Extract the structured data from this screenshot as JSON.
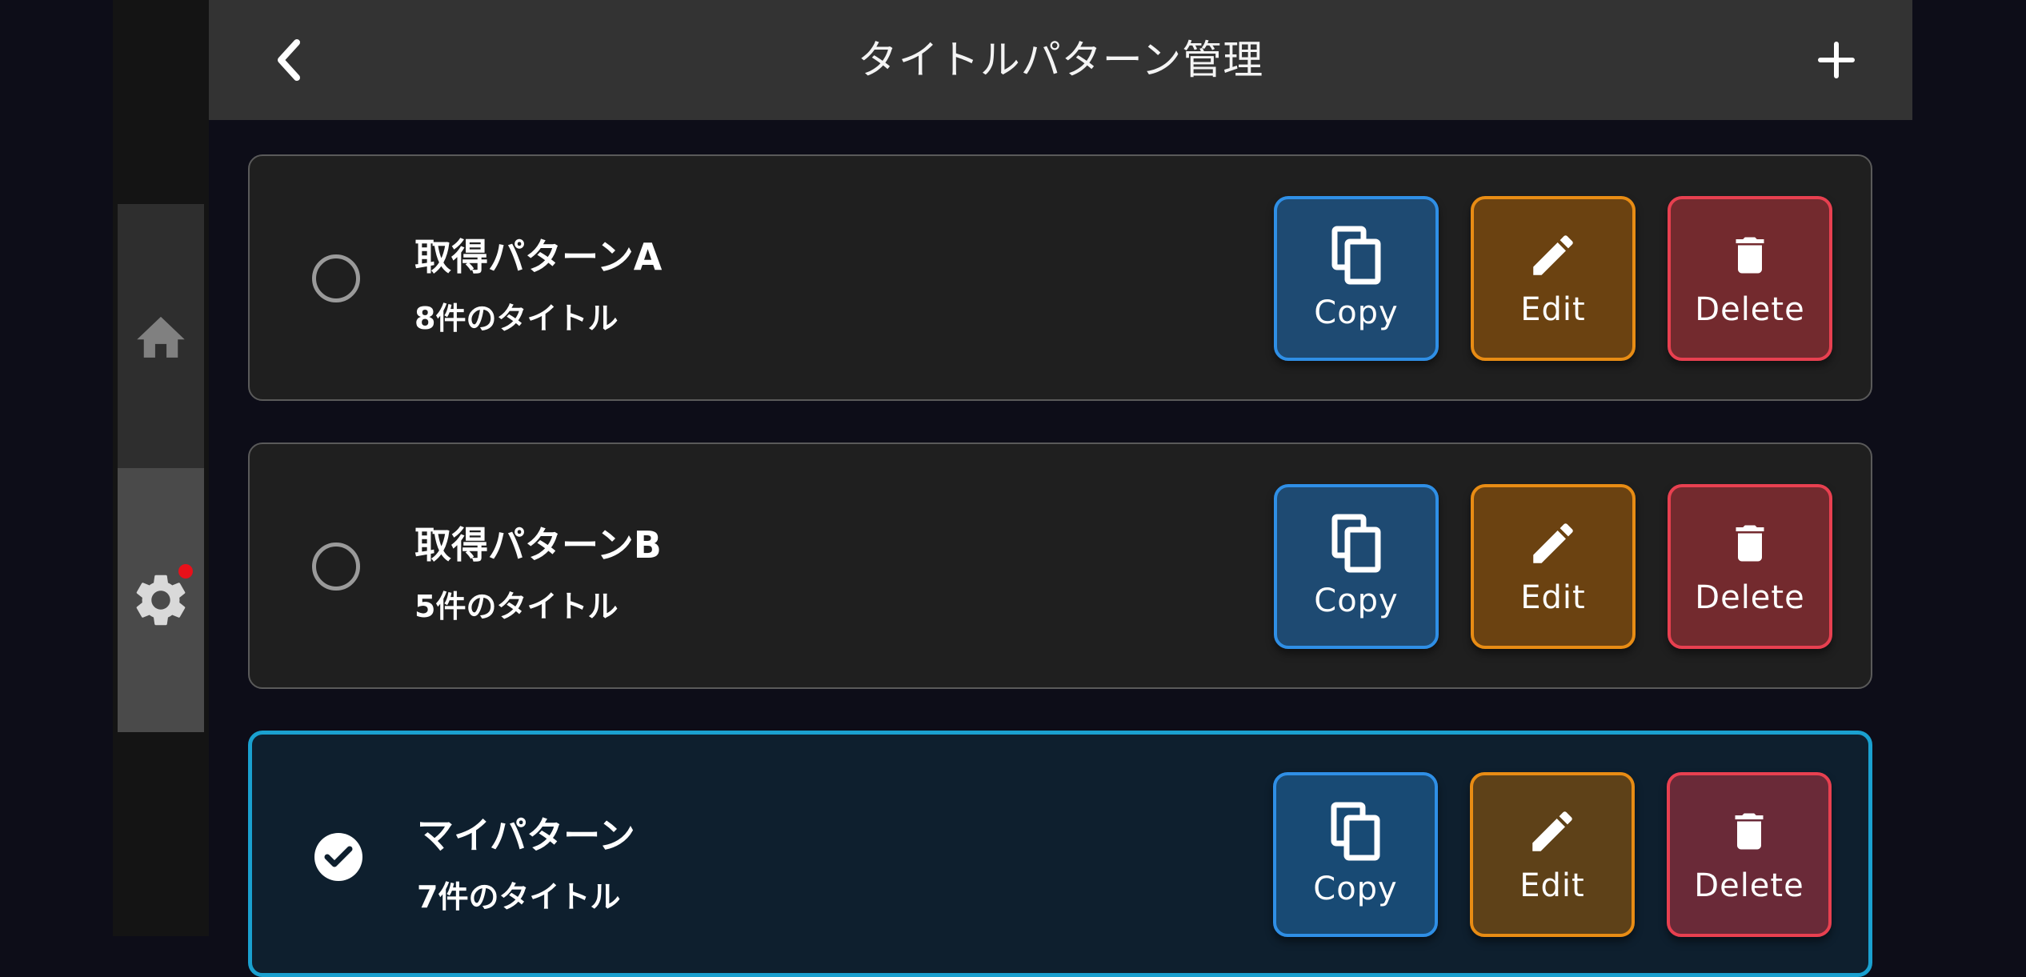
{
  "header": {
    "title": "タイトルパターン管理",
    "back_icon": "chevron-left-icon",
    "add_icon": "plus-icon"
  },
  "nav": {
    "items": [
      {
        "name": "home",
        "icon": "home-icon",
        "active": false
      },
      {
        "name": "settings",
        "icon": "gear-icon",
        "active": true,
        "notification": true
      }
    ]
  },
  "patterns": [
    {
      "name": "取得パターンA",
      "count_text": "8件のタイトル",
      "selected": false
    },
    {
      "name": "取得パターンB",
      "count_text": "5件のタイトル",
      "selected": false
    },
    {
      "name": "マイパターン",
      "count_text": "7件のタイトル",
      "selected": true
    }
  ],
  "actions": {
    "copy_label": "Copy",
    "edit_label": "Edit",
    "delete_label": "Delete"
  },
  "colors": {
    "background": "#0d0d18",
    "header": "#333333",
    "card": "#1f1f1f",
    "selected_border": "#1aa0cf",
    "copy": "#2f8fe6",
    "edit": "#e88c14",
    "delete": "#e84050",
    "notification_dot": "#e8101a"
  }
}
